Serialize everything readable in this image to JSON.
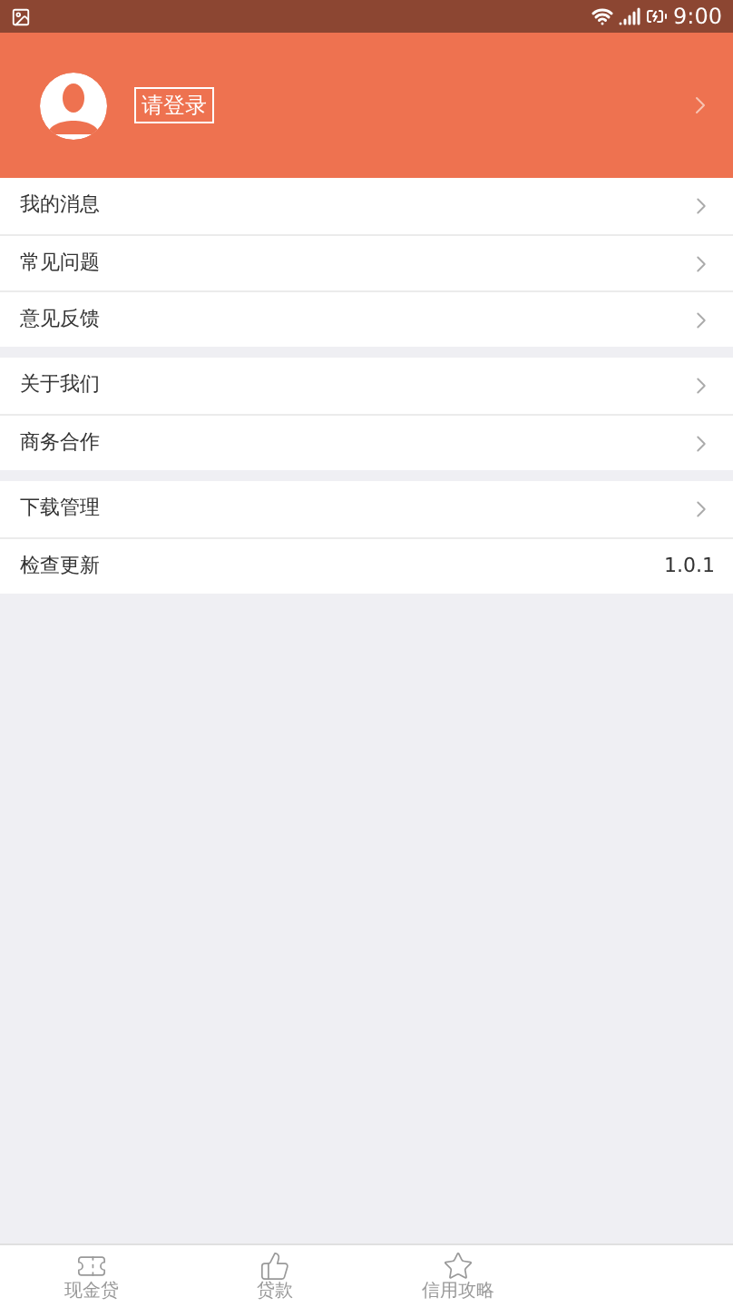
{
  "status_bar": {
    "time": "9:00"
  },
  "header": {
    "login_label": "请登录"
  },
  "menu_groups": [
    {
      "items": [
        {
          "label": "我的消息"
        },
        {
          "label": "常见问题"
        },
        {
          "label": "意见反馈"
        }
      ]
    },
    {
      "items": [
        {
          "label": "关于我们"
        },
        {
          "label": "商务合作"
        }
      ]
    },
    {
      "items": [
        {
          "label": "下载管理",
          "kind": "link"
        },
        {
          "label": "检查更新",
          "kind": "value",
          "value": "1.0.1"
        }
      ]
    }
  ],
  "tab_bar": [
    {
      "label": "现金贷"
    },
    {
      "label": "贷款"
    },
    {
      "label": "信用攻略"
    }
  ]
}
